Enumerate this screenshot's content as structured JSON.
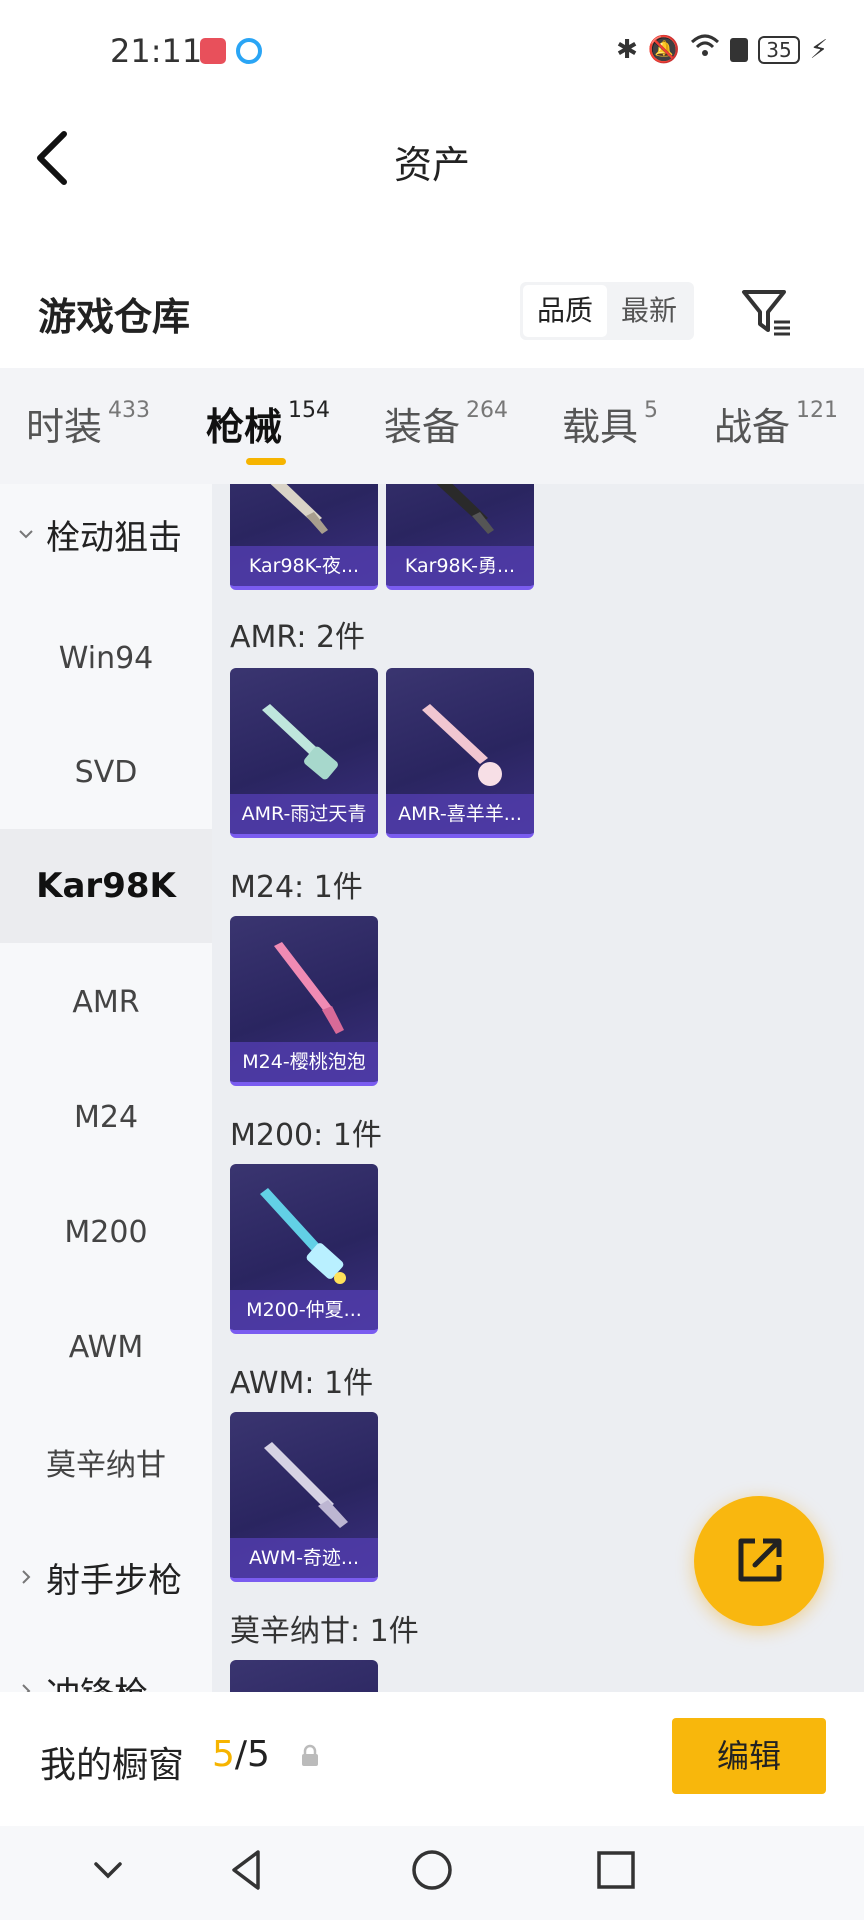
{
  "status_bar": {
    "time": "21:11",
    "battery": "35"
  },
  "header": {
    "title": "资产"
  },
  "section": {
    "heading": "游戏仓库",
    "sort_options": [
      "品质",
      "最新"
    ],
    "sort_selected": "品质"
  },
  "tabs": [
    {
      "label": "时装",
      "count": "433"
    },
    {
      "label": "枪械",
      "count": "154",
      "active": true
    },
    {
      "label": "装备",
      "count": "264"
    },
    {
      "label": "载具",
      "count": "5"
    },
    {
      "label": "战备",
      "count": "121"
    }
  ],
  "sidebar": {
    "items": [
      {
        "label": "栓动狙击",
        "type": "group-expanded"
      },
      {
        "label": "Win94"
      },
      {
        "label": "SVD"
      },
      {
        "label": "Kar98K",
        "active": true
      },
      {
        "label": "AMR"
      },
      {
        "label": "M24"
      },
      {
        "label": "M200"
      },
      {
        "label": "AWM"
      },
      {
        "label": "莫辛纳甘"
      },
      {
        "label": "射手步枪",
        "type": "group-collapsed"
      },
      {
        "label": "冲锋枪",
        "type": "group-collapsed"
      }
    ]
  },
  "main": {
    "top_cards": [
      {
        "name": "Kar98K-夜..."
      },
      {
        "name": "Kar98K-勇..."
      }
    ],
    "groups": [
      {
        "label": "AMR: 2件",
        "cards": [
          {
            "name": "AMR-雨过天青",
            "color": "#bfe6dd"
          },
          {
            "name": "AMR-喜羊羊...",
            "color": "#f1c6d1"
          }
        ]
      },
      {
        "label": "M24: 1件",
        "cards": [
          {
            "name": "M24-樱桃泡泡",
            "color": "#f08bb4"
          }
        ]
      },
      {
        "label": "M200: 1件",
        "cards": [
          {
            "name": "M200-仲夏...",
            "color": "#62d0e6"
          }
        ]
      },
      {
        "label": "AWM: 1件",
        "cards": [
          {
            "name": "AWM-奇迹...",
            "color": "#d6d2e4"
          }
        ]
      },
      {
        "label": "莫辛纳甘: 1件",
        "cards": []
      }
    ]
  },
  "bottom": {
    "label": "我的橱窗",
    "count_current": "5",
    "count_total": "/5",
    "edit_label": "编辑"
  },
  "colors": {
    "accent": "#f8b70c",
    "card_bg": "#2d2863",
    "card_label": "#5a44b8"
  }
}
